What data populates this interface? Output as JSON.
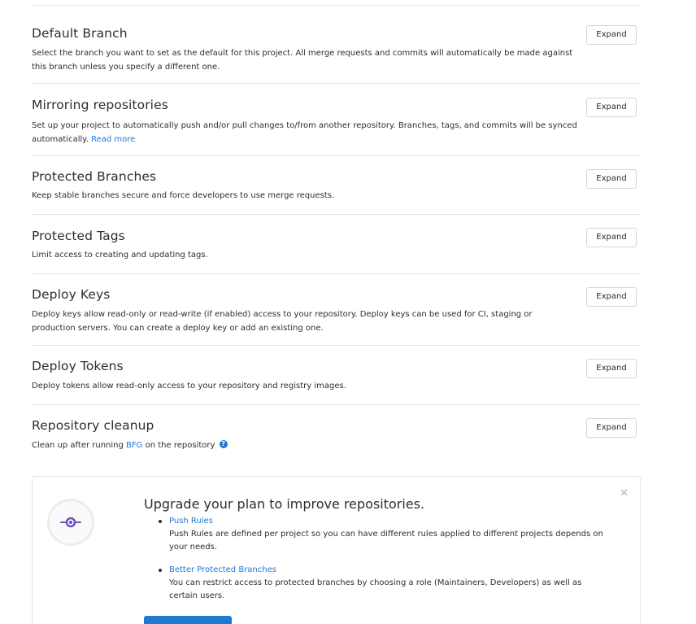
{
  "sections": [
    {
      "title": "Default Branch",
      "description": "Select the branch you want to set as the default for this project. All merge requests and commits will automatically be made against this branch unless you specify a different one.",
      "button": "Expand"
    },
    {
      "title": "Mirroring repositories",
      "description": "Set up your project to automatically push and/or pull changes to/from another repository. Branches, tags, and commits will be synced automatically.",
      "link": "Read more",
      "button": "Expand"
    },
    {
      "title": "Protected Branches",
      "description": "Keep stable branches secure and force developers to use merge requests.",
      "button": "Expand"
    },
    {
      "title": "Protected Tags",
      "description": "Limit access to creating and updating tags.",
      "button": "Expand"
    },
    {
      "title": "Deploy Keys",
      "description": "Deploy keys allow read-only or read-write (if enabled) access to your repository. Deploy keys can be used for CI, staging or production servers. You can create a deploy key or add an existing one.",
      "button": "Expand"
    },
    {
      "title": "Deploy Tokens",
      "description": "Deploy tokens allow read-only access to your repository and registry images.",
      "button": "Expand"
    },
    {
      "title": "Repository cleanup",
      "description_before": "Clean up after running",
      "link": "BFG",
      "description_after": "on the repository",
      "help_icon": "question-circle-icon",
      "button": "Expand"
    }
  ],
  "promo": {
    "title": "Upgrade your plan to improve repositories.",
    "close_icon": "close-icon",
    "items": [
      {
        "link": "Push Rules",
        "text": "Push Rules are defined per project so you can have different rules applied to different projects depends on your needs."
      },
      {
        "link": "Better Protected Branches",
        "text": "You can restrict access to protected branches by choosing a role (Maintainers, Developers) as well as certain users."
      }
    ],
    "cta_label": "",
    "accent_color": "#1f78d1",
    "illustration_color": "#6b4fbb"
  }
}
